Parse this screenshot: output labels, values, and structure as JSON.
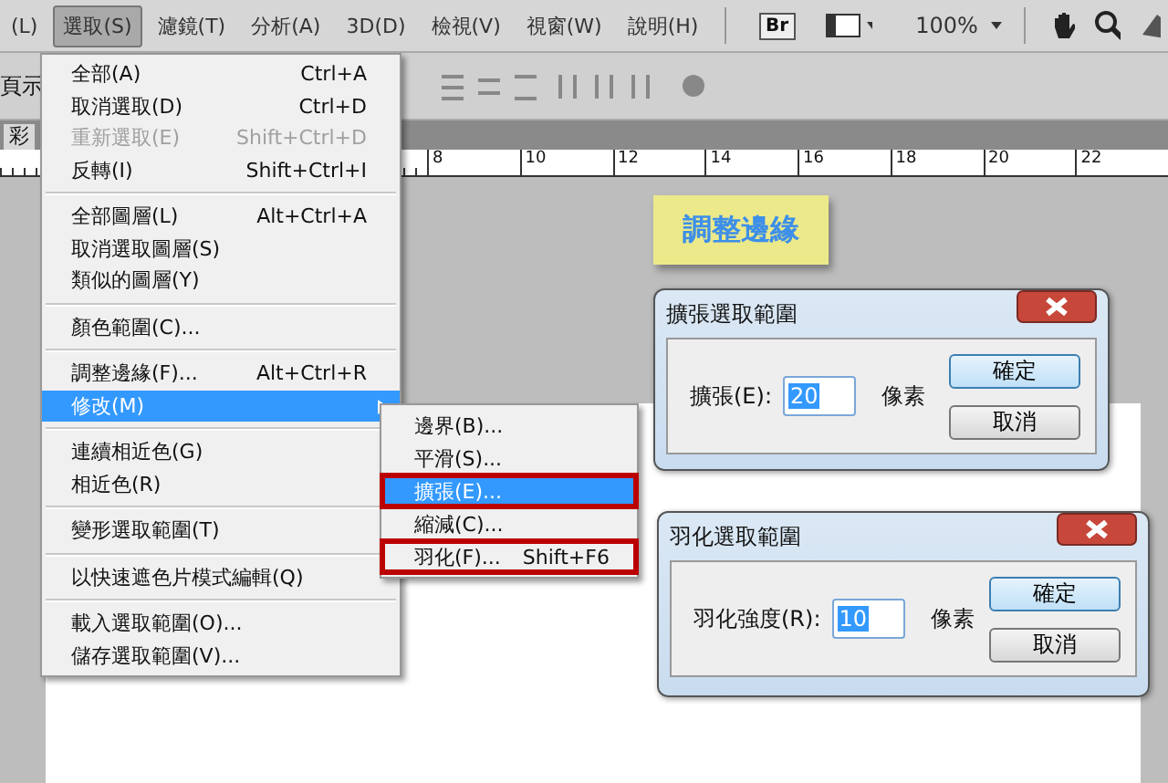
{
  "menubar": [
    {
      "label": "(L)",
      "selected": false
    },
    {
      "label": "選取(S)",
      "selected": true
    },
    {
      "label": "濾鏡(T)",
      "selected": false
    },
    {
      "label": "分析(A)",
      "selected": false
    },
    {
      "label": "3D(D)",
      "selected": false
    },
    {
      "label": "檢視(V)",
      "selected": false
    },
    {
      "label": "視窗(W)",
      "selected": false
    },
    {
      "label": "說明(H)",
      "selected": false
    }
  ],
  "toolbar": {
    "bridge_label": "Br",
    "zoom": "100%",
    "options_label": "頁示",
    "tab_label": "彩"
  },
  "ruler": [
    "8",
    "10",
    "12",
    "14",
    "16",
    "18",
    "20",
    "22"
  ],
  "menu": [
    [
      {
        "label": "全部(A)",
        "shortcut": "Ctrl+A",
        "disabled": false,
        "selected": false,
        "submenu": false
      },
      {
        "label": "取消選取(D)",
        "shortcut": "Ctrl+D",
        "disabled": false,
        "selected": false,
        "submenu": false
      },
      {
        "label": "重新選取(E)",
        "shortcut": "Shift+Ctrl+D",
        "disabled": true,
        "selected": false,
        "submenu": false
      },
      {
        "label": "反轉(I)",
        "shortcut": "Shift+Ctrl+I",
        "disabled": false,
        "selected": false,
        "submenu": false
      }
    ],
    [
      {
        "label": "全部圖層(L)",
        "shortcut": "Alt+Ctrl+A",
        "disabled": false,
        "selected": false,
        "submenu": false
      },
      {
        "label": "取消選取圖層(S)",
        "disabled": false,
        "selected": false,
        "submenu": false
      },
      {
        "label": "類似的圖層(Y)",
        "disabled": false,
        "selected": false,
        "submenu": false
      }
    ],
    [
      {
        "label": "顏色範圍(C)...",
        "disabled": false,
        "selected": false,
        "submenu": false
      }
    ],
    [
      {
        "label": "調整邊緣(F)...",
        "shortcut": "Alt+Ctrl+R",
        "disabled": false,
        "selected": false,
        "submenu": false
      },
      {
        "label": "修改(M)",
        "disabled": false,
        "selected": true,
        "submenu": true
      }
    ],
    [
      {
        "label": "連續相近色(G)",
        "disabled": false,
        "selected": false,
        "submenu": false
      },
      {
        "label": "相近色(R)",
        "disabled": false,
        "selected": false,
        "submenu": false
      }
    ],
    [
      {
        "label": "變形選取範圍(T)",
        "disabled": false,
        "selected": false,
        "submenu": false
      }
    ],
    [
      {
        "label": "以快速遮色片模式編輯(Q)",
        "disabled": false,
        "selected": false,
        "submenu": false
      }
    ],
    [
      {
        "label": "載入選取範圍(O)...",
        "disabled": false,
        "selected": false,
        "submenu": false
      },
      {
        "label": "儲存選取範圍(V)...",
        "disabled": false,
        "selected": false,
        "submenu": false
      }
    ]
  ],
  "submenu": [
    {
      "label": "邊界(B)...",
      "selected": false,
      "outlined": false
    },
    {
      "label": "平滑(S)...",
      "selected": false,
      "outlined": false
    },
    {
      "label": "擴張(E)...",
      "selected": true,
      "outlined": true
    },
    {
      "label": "縮減(C)...",
      "selected": false,
      "outlined": false
    },
    {
      "label": "羽化(F)...",
      "shortcut": "Shift+F6",
      "selected": false,
      "outlined": true
    }
  ],
  "caption": "調整邊緣",
  "dialogs": [
    {
      "title": "擴張選取範圍",
      "field_label": "擴張(E):",
      "value": "20",
      "unit": "像素",
      "buttons": [
        {
          "label": "確定",
          "default": true
        },
        {
          "label": "取消",
          "default": false
        }
      ]
    },
    {
      "title": "羽化選取範圍",
      "field_label": "羽化強度(R):",
      "value": "10",
      "unit": "像素",
      "buttons": [
        {
          "label": "確定",
          "default": true
        },
        {
          "label": "取消",
          "default": false
        }
      ]
    }
  ]
}
